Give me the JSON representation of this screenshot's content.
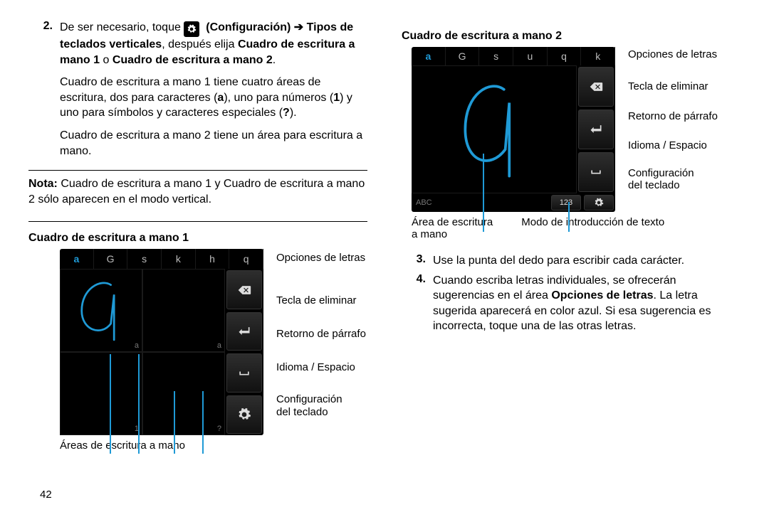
{
  "page_number": "42",
  "left": {
    "step2_num": "2.",
    "step2_pre": "De ser necesario, toque ",
    "step2_conf": "(Configuración)",
    "step2_arrow": "➔",
    "step2_tipos": "Tipos de teclados verticales",
    "step2_mid": ", después elija ",
    "step2_b1": "Cuadro de escritura a mano 1",
    "step2_or": " o ",
    "step2_b2": "Cuadro de escritura a mano 2",
    "step2_end": ".",
    "p1": "Cuadro de escritura a mano 1 tiene cuatro áreas de escritura, dos para caracteres (",
    "p1_a": "a",
    "p1_mid": "), uno para números (",
    "p1_1": "1",
    "p1_mid2": ") y uno para símbolos y caracteres especiales (",
    "p1_q": "?",
    "p1_end": ").",
    "p2": "Cuadro de escritura a mano 2 tiene un área para escritura a mano.",
    "note_label": "Nota:",
    "note": " Cuadro de escritura a mano 1 y Cuadro de escritura a mano 2 sólo aparecen en el modo vertical.",
    "sub1": "Cuadro de escritura a mano 1",
    "kp1_opts": [
      "a",
      "G",
      "s",
      "k",
      "h",
      "q"
    ],
    "kp1_cells": [
      "a",
      "a",
      "1",
      "?"
    ],
    "labels1": {
      "opt": "Opciones de letras",
      "del": "Tecla de eliminar",
      "ret": "Retorno de párrafo",
      "spc": "Idioma / Espacio",
      "cfg": "Configuración",
      "cfg2": "del teclado"
    },
    "below1": "Áreas de escritura a mano"
  },
  "right": {
    "sub2": "Cuadro de escritura a mano 2",
    "kp2_opts": [
      "a",
      "G",
      "s",
      "u",
      "q",
      "k"
    ],
    "kp2_abc": "ABC",
    "kp2_mode": "123",
    "labels2": {
      "opt": "Opciones de letras",
      "del": "Tecla de eliminar",
      "ret": "Retorno de párrafo",
      "spc": "Idioma / Espacio",
      "cfg": "Configuración",
      "cfg2": "del teclado"
    },
    "below2a": "Área de escritura",
    "below2a2": "a mano",
    "below2b": "Modo de introducción de texto",
    "step3_num": "3.",
    "step3": "Use la punta del dedo para escribir cada carácter.",
    "step4_num": "4.",
    "step4_a": "Cuando escriba letras individuales, se ofrecerán sugerencias en el área ",
    "step4_b": "Opciones de letras",
    "step4_c": ". La letra sugerida aparecerá en color azul. Si esa sugerencia es incorrecta, toque una de las otras letras."
  }
}
